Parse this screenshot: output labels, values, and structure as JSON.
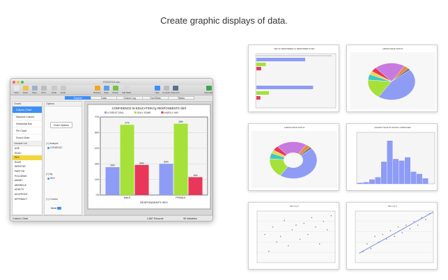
{
  "headline": "Create graphic displays of data.",
  "window": {
    "title": "GSS2016.sav",
    "toolbar": [
      {
        "label": "New",
        "color": "#e9e9e9"
      },
      {
        "label": "Open",
        "color": "#f2c14e"
      },
      {
        "label": "Save",
        "color": "#9fb3c8"
      },
      {
        "label": "Print",
        "color": "#bdbdbd"
      },
      {
        "label": "Undo",
        "color": "#c9c9c9"
      },
      {
        "label": "Redo",
        "color": "#c9c9c9"
      },
      {
        "label": "Bracket",
        "color": "#f5a623"
      },
      {
        "label": "Stats",
        "color": "#5aa0e8"
      },
      {
        "label": "Charts",
        "color": "#7bbf4a"
      },
      {
        "label": "Add Table",
        "color": "#d8d8d8"
      },
      {
        "label": "Help",
        "color": "#3d8ff7"
      },
      {
        "label": "Console",
        "color": "#bcbcbc"
      },
      {
        "label": "Data Info",
        "color": "#5b6f8f"
      },
      {
        "label": "Calculate",
        "color": "#3aa64c"
      }
    ],
    "tabs": [
      "Explore",
      "Data",
      "Output Log",
      "SumStats",
      "Tables"
    ],
    "active_tab": "Explore",
    "sidebar": {
      "charts_heading": "Charts",
      "chart_types": [
        "Column Chart",
        "Stacked Column",
        "Horizontal Bar",
        "Pie Chart",
        "Donut Chart"
      ],
      "selected_chart": "Column Chart",
      "variable_heading": "Variable List",
      "variables": [
        "AGE",
        "EDUC",
        "SEX",
        "RACE",
        "WRKSTAT",
        "PARTYID",
        "POLVIEWS",
        "ABANY",
        "ABSINGLE",
        "ADULTS",
        "ADVFRONT",
        "AFFRMACT"
      ],
      "selected_variable": "SEX"
    },
    "options": {
      "heading": "Options",
      "chart_options_button": "Chart Options",
      "analyze_label": "(+) Analyze",
      "analyze_var": "CONEDUC",
      "by_label": "(+) By",
      "by_var": "SEX",
      "control_label": "(+) Control",
      "none_label": "None"
    },
    "status": {
      "left": "Column Chart",
      "records": "2,867 Records",
      "variables": "96 Variables"
    }
  },
  "colors": {
    "blue": "#8e9cf6",
    "green": "#a6e13a",
    "red": "#e8375a",
    "yellow": "#f0d543",
    "purple": "#c77be0",
    "teal": "#41c7c2",
    "accent": "#3d8ff7"
  },
  "chart_data": [
    {
      "type": "bar",
      "title": "CONFIDENCE IN EDUCATION by RESPONDENTS SEX",
      "categories": [
        "MALE",
        "FEMALE"
      ],
      "series": [
        {
          "name": "A GREAT DEAL",
          "values": [
            25,
            28
          ]
        },
        {
          "name": "ONLY SOME",
          "values": [
            63,
            64
          ]
        },
        {
          "name": "HARDLY ANY",
          "values": [
            27,
            16
          ]
        }
      ],
      "ylim": [
        0,
        70
      ],
      "yticks": [
        "0%",
        "14%",
        "28%",
        "42%",
        "56%",
        "70%"
      ],
      "xlabel": "RESPONDENTS SEX",
      "ylabel": "",
      "data_labels": [
        "25%",
        "63%",
        "27%",
        "28%",
        "64%",
        "16%"
      ]
    },
    {
      "type": "bar",
      "orientation": "horizontal",
      "title": "SEX OF RESPONDENT by RESPONDENTS SEX",
      "values": [
        1580,
        1290
      ]
    },
    {
      "type": "pie",
      "title": "LABOR FORCE STATUS",
      "values": [
        45,
        17,
        5,
        3,
        4,
        21,
        3,
        2
      ]
    },
    {
      "type": "pie",
      "title": "LABOR FORCE STATUS",
      "donut": true,
      "values": [
        45,
        17,
        5,
        3,
        4,
        21,
        3,
        2
      ]
    },
    {
      "type": "bar",
      "title": "HIGHEST YEAR OF SCHOOL COMPLETED",
      "values": [
        2,
        3,
        8,
        12,
        40,
        78,
        45,
        42,
        48,
        22,
        18,
        10
      ]
    },
    {
      "type": "scatter",
      "title": "Plot Y by X",
      "x": [
        4,
        6,
        8,
        10,
        12,
        14,
        16,
        18,
        20,
        22,
        24,
        26,
        28,
        30,
        32,
        34,
        36,
        38
      ],
      "y": [
        30,
        12,
        38,
        22,
        28,
        45,
        18,
        35,
        40,
        25,
        42,
        30,
        48,
        38,
        20,
        44,
        35,
        50
      ]
    },
    {
      "type": "scatter",
      "title": "Plot Y by X",
      "x": [
        4,
        6,
        8,
        10,
        12,
        14,
        16,
        18,
        20,
        22,
        24,
        26,
        28,
        30,
        32,
        34,
        36,
        38
      ],
      "y": [
        12,
        20,
        15,
        28,
        22,
        30,
        25,
        34,
        28,
        38,
        32,
        40,
        36,
        44,
        40,
        48,
        46,
        52
      ],
      "fit_line": true
    }
  ]
}
